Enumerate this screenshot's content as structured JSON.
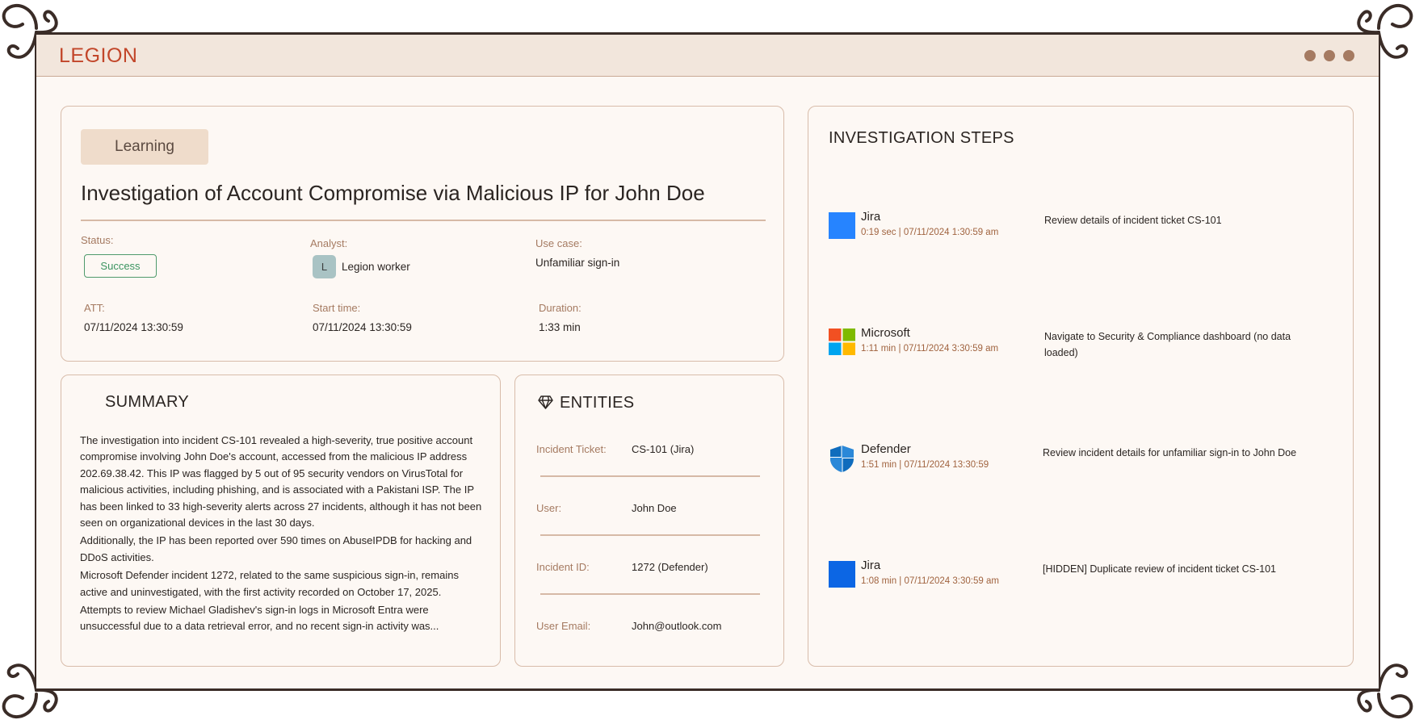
{
  "app": {
    "logo": "LEGION"
  },
  "investigation": {
    "tag": "Learning",
    "title": "Investigation of Account Compromise via Malicious IP for John Doe",
    "status_label": "Status:",
    "status_value": "Success",
    "analyst_label": "Analyst:",
    "analyst_initial": "L",
    "analyst_name": "Legion worker",
    "use_case_label": "Use case:",
    "use_case_value": "Unfamiliar sign-in",
    "att_label": "ATT:",
    "att_value": "07/11/2024 13:30:59",
    "start_label": "Start time:",
    "start_value": "07/11/2024 13:30:59",
    "duration_label": "Duration:",
    "duration_value": "1:33 min"
  },
  "summary": {
    "title": "SUMMARY",
    "paragraphs": [
      "The investigation into incident CS-101 revealed a high-severity, true positive account compromise involving John Doe's account, accessed from the malicious IP address 202.69.38.42. This IP was flagged by 5 out of 95 security vendors on VirusTotal for malicious activities, including phishing, and is associated with a Pakistani ISP. The IP has been linked to 33 high-severity alerts across 27 incidents, although it has not been seen on organizational devices in the last 30 days.",
      "Additionally, the IP has been reported over 590 times on AbuseIPDB for hacking and DDoS activities.",
      "Microsoft Defender incident 1272, related to the same suspicious sign-in, remains active and uninvestigated, with the first activity recorded on October 17, 2025.",
      "Attempts to review Michael Gladishev's sign-in logs in Microsoft Entra were unsuccessful due to a data retrieval error, and no recent sign-in activity was..."
    ]
  },
  "entities": {
    "title": "ENTITIES",
    "rows": [
      {
        "label": "Incident Ticket:",
        "value": "CS-101 (Jira)"
      },
      {
        "label": "User:",
        "value": "John Doe"
      },
      {
        "label": "Incident ID:",
        "value": "1272 (Defender)"
      },
      {
        "label": "User Email:",
        "value": "John@outlook.com"
      }
    ]
  },
  "steps": {
    "title": "INVESTIGATION STEPS",
    "items": [
      {
        "app": "Jira",
        "icon": "jira-icon",
        "time": "0:19 sec  |  07/11/2024 1:30:59 am",
        "desc": "Review details of incident ticket CS-101"
      },
      {
        "app": "Microsoft",
        "icon": "microsoft-icon",
        "time": "1:11 min  |  07/11/2024 3:30:59 am",
        "desc": "Navigate to Security & Compliance dashboard (no data loaded)"
      },
      {
        "app": "Defender",
        "icon": "defender-shield-icon",
        "time": "1:51 min  |  07/11/2024 13:30:59",
        "desc": "Review incident details for unfamiliar sign-in to John Doe"
      },
      {
        "app": "Jira",
        "icon": "jira-icon",
        "time": "1:08 min  |  07/11/2024 3:30:59 am",
        "desc": "[HIDDEN] Duplicate review of incident ticket CS-101"
      }
    ]
  },
  "colors": {
    "accent": "#c2462a",
    "label": "#a57a61",
    "success": "#3b9460",
    "jira_blue": "#2684ff",
    "card_border": "#d8bcaa"
  }
}
